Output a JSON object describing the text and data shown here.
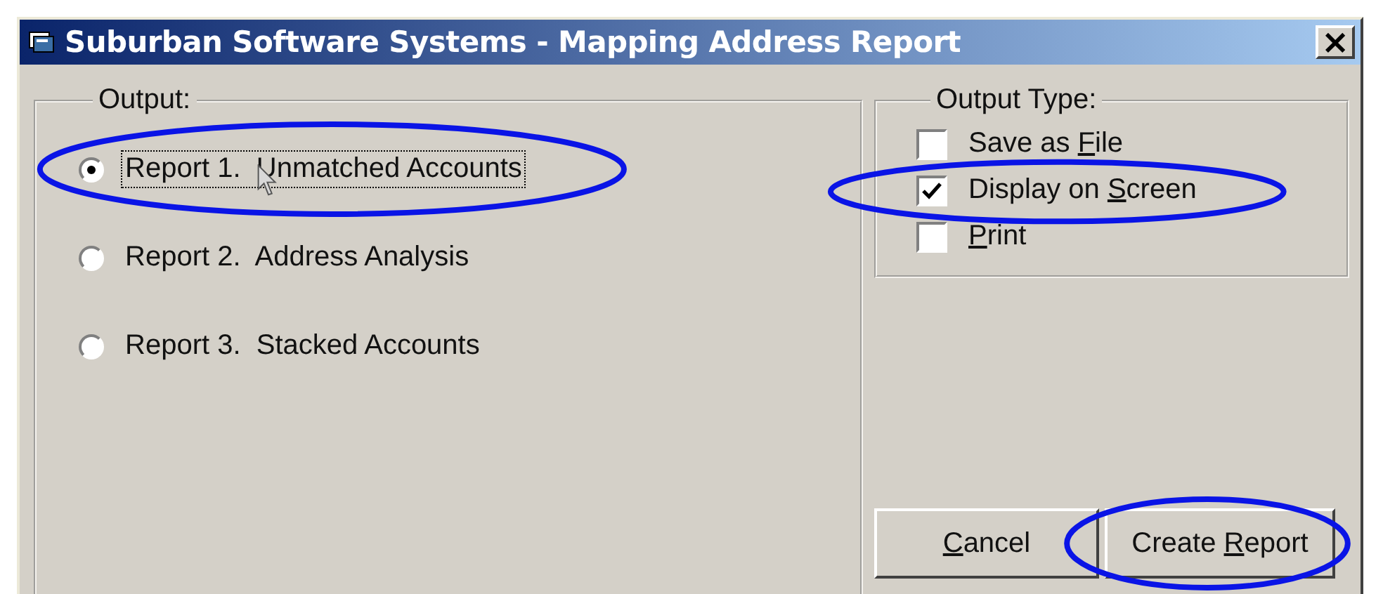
{
  "window": {
    "title": "Suburban Software Systems - Mapping Address Report",
    "close": "×"
  },
  "output": {
    "legend": "Output:",
    "options": [
      {
        "label": "Report 1.  Unmatched Accounts",
        "selected": true,
        "focused": true,
        "highlighted": true,
        "pointer": true
      },
      {
        "label": "Report 2.  Address Analysis",
        "selected": false,
        "focused": false,
        "highlighted": false,
        "pointer": false
      },
      {
        "label": "Report 3.  Stacked Accounts",
        "selected": false,
        "focused": false,
        "highlighted": false,
        "pointer": false
      }
    ]
  },
  "output_type": {
    "legend": "Output Type:",
    "options": [
      {
        "label_before": "Save as ",
        "access_key": "F",
        "label_after": "ile",
        "checked": false,
        "highlighted": false
      },
      {
        "label_before": "Display on ",
        "access_key": "S",
        "label_after": "creen",
        "checked": true,
        "highlighted": true
      },
      {
        "access_key": "P",
        "label_after": "rint",
        "checked": false,
        "highlighted": false
      }
    ]
  },
  "buttons": [
    {
      "access_key": "C",
      "label_after": "ancel",
      "highlighted": false
    },
    {
      "label_before": "Create ",
      "access_key": "R",
      "label_after": "eport",
      "highlighted": true
    }
  ]
}
